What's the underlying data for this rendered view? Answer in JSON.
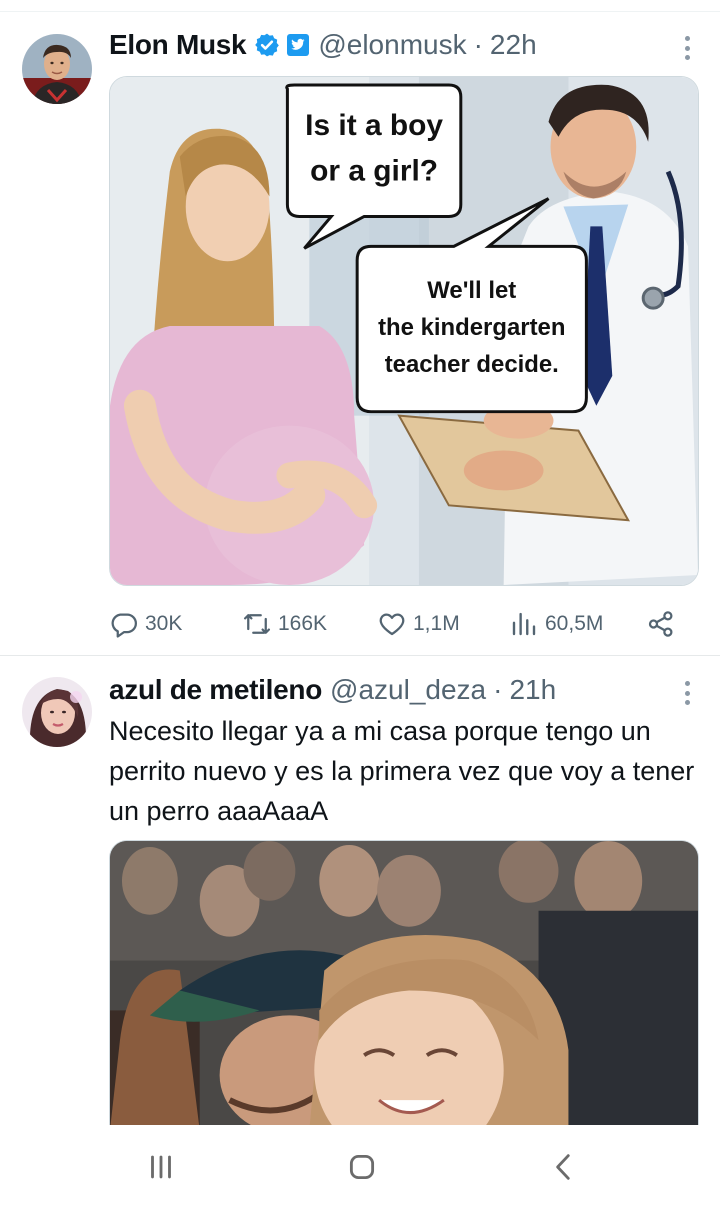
{
  "tweets": [
    {
      "author": "Elon Musk",
      "handle": "@elonmusk",
      "separator": "·",
      "time": "22h",
      "verified": true,
      "meme": {
        "bubble1": [
          "Is it a boy",
          "or a girl?"
        ],
        "bubble2": [
          "We'll let",
          "the kindergarten",
          "teacher decide."
        ]
      },
      "stats": {
        "replies": "30K",
        "retweets": "166K",
        "likes": "1,1M",
        "views": "60,5M"
      }
    },
    {
      "author": "azul de metileno",
      "handle": "@azul_deza",
      "separator": "·",
      "time": "21h",
      "text": "Necesito llegar ya a mi casa porque tengo un perrito nuevo y es la primera vez que voy a tener un perro aaaAaaA"
    }
  ],
  "icons": {
    "verified": "verified-badge-icon",
    "affiliate": "affiliate-badge-icon",
    "more": "more-options-icon",
    "reply": "reply-icon",
    "retweet": "retweet-icon",
    "like": "heart-icon",
    "views": "views-icon",
    "share": "share-icon",
    "nav_recent": "recent-apps-icon",
    "nav_home": "home-icon",
    "nav_back": "back-icon"
  },
  "colors": {
    "text": "#0f1419",
    "secondary": "#536471",
    "verified_blue": "#1d9bf0",
    "border": "#cfd9de"
  }
}
